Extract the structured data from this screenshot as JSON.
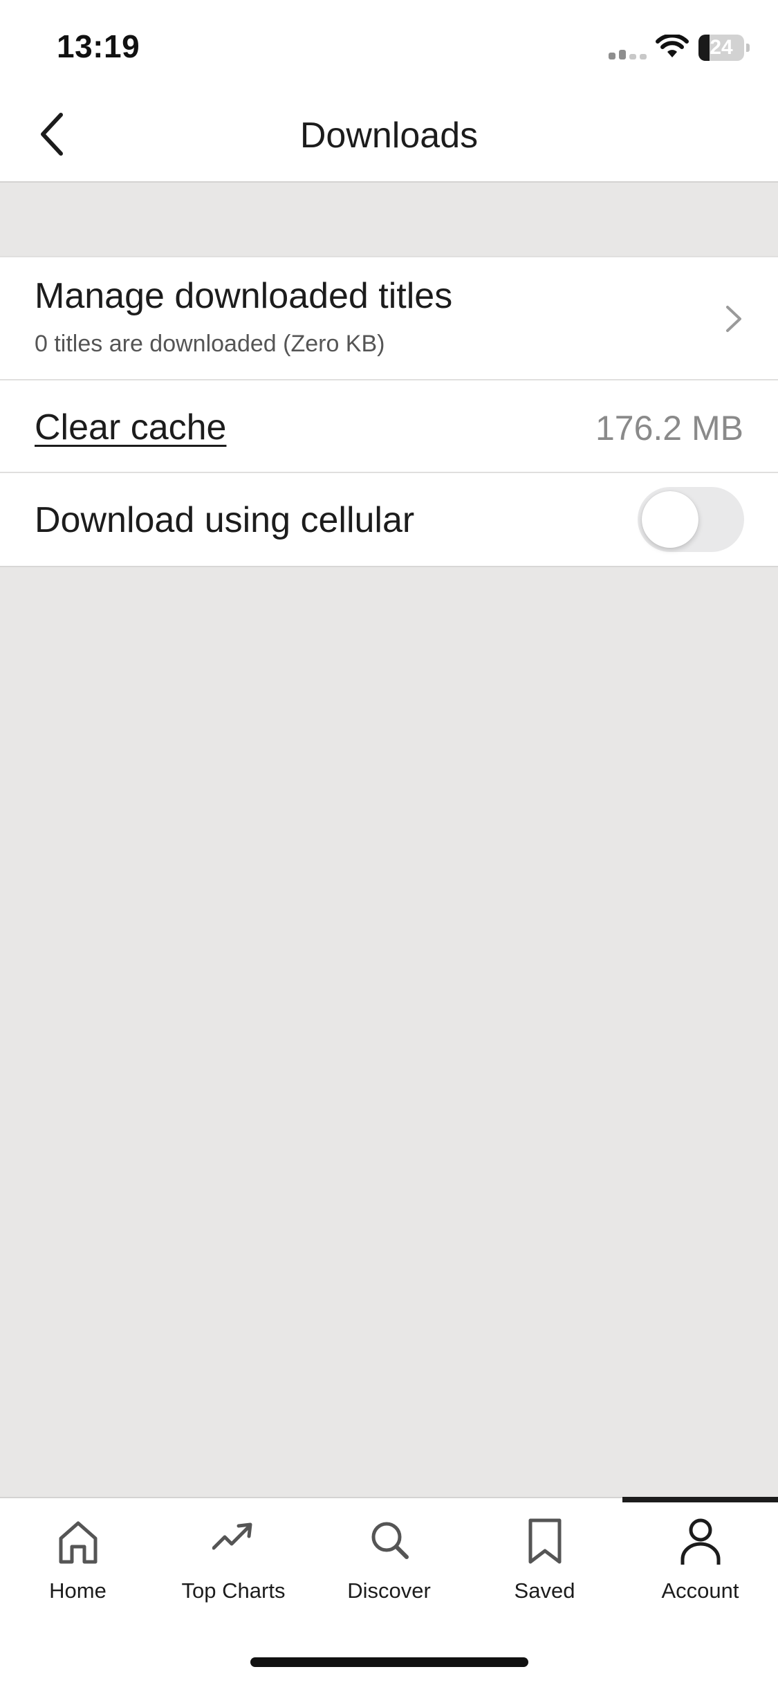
{
  "status_bar": {
    "time": "13:19",
    "battery_level": 24,
    "battery_text": "24"
  },
  "header": {
    "title": "Downloads",
    "back_icon": "chevron-left-icon"
  },
  "settings": {
    "manage": {
      "title": "Manage downloaded titles",
      "subtitle": "0 titles are downloaded (Zero KB)",
      "icon": "chevron-right-icon"
    },
    "cache": {
      "label": "Clear cache",
      "size": "176.2 MB"
    },
    "cellular": {
      "label": "Download using cellular",
      "enabled": false
    }
  },
  "tab_bar": {
    "tabs": [
      {
        "label": "Home",
        "icon": "home-icon",
        "active": false
      },
      {
        "label": "Top Charts",
        "icon": "trending-up-icon",
        "active": false
      },
      {
        "label": "Discover",
        "icon": "search-icon",
        "active": false
      },
      {
        "label": "Saved",
        "icon": "bookmark-icon",
        "active": false
      },
      {
        "label": "Account",
        "icon": "person-icon",
        "active": true
      }
    ]
  },
  "colors": {
    "background": "#e8e7e6",
    "surface": "#ffffff",
    "text": "#1c1c1c",
    "secondary_text": "#8a8a8a",
    "toggle_off": "#e9e9ea"
  }
}
